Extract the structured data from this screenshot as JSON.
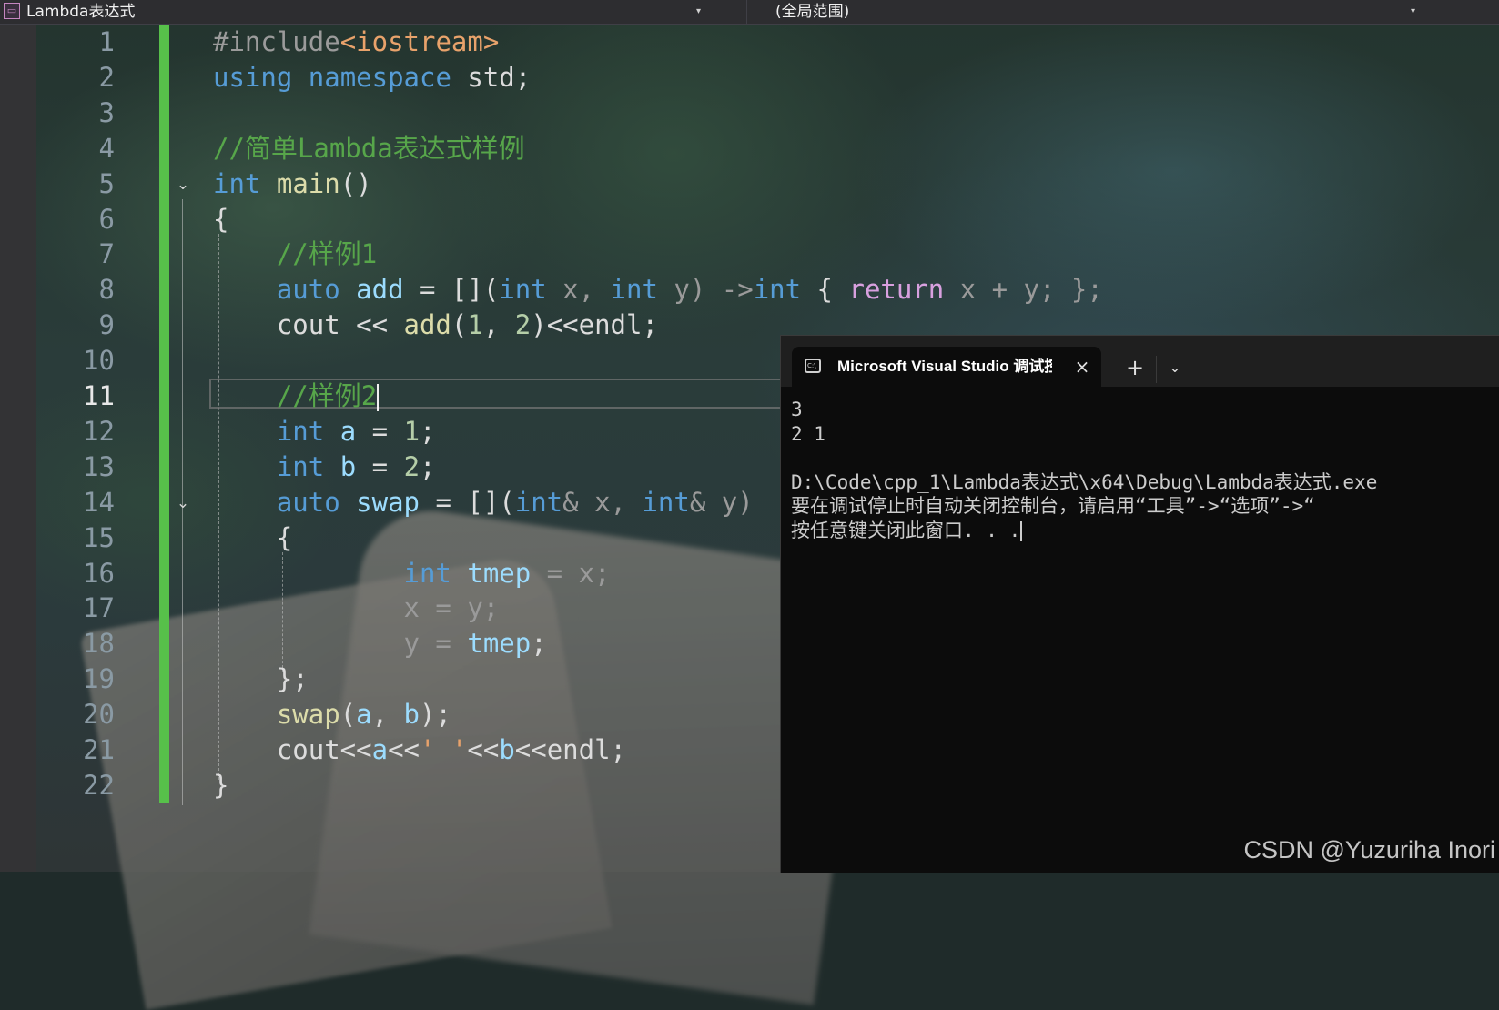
{
  "navbar": {
    "file_icon": "class-file-icon",
    "project": "Lambda表达式",
    "scope": "(全局范围)",
    "dropdown_icon": "▾"
  },
  "editor": {
    "line_numbers": [
      "1",
      "2",
      "3",
      "4",
      "5",
      "6",
      "7",
      "8",
      "9",
      "10",
      "11",
      "12",
      "13",
      "14",
      "15",
      "16",
      "17",
      "18",
      "19",
      "20",
      "21",
      "22"
    ],
    "active_line": 11,
    "fold_icon": "chevron-down-icon",
    "lines": [
      [
        {
          "t": "#include",
          "c": "pp"
        },
        {
          "t": "<iostream>",
          "c": "str"
        }
      ],
      [
        {
          "t": "using",
          "c": "kw"
        },
        {
          "t": " ",
          "c": "op"
        },
        {
          "t": "namespace",
          "c": "kw"
        },
        {
          "t": " std;",
          "c": "op"
        }
      ],
      [],
      [
        {
          "t": "//简单Lambda表达式样例",
          "c": "cm"
        }
      ],
      [
        {
          "t": "int",
          "c": "kw"
        },
        {
          "t": " ",
          "c": "op"
        },
        {
          "t": "main",
          "c": "fn"
        },
        {
          "t": "()",
          "c": "op"
        }
      ],
      [
        {
          "t": "{",
          "c": "op"
        }
      ],
      [
        {
          "t": "    ",
          "c": "op"
        },
        {
          "t": "//样例1",
          "c": "cm"
        }
      ],
      [
        {
          "t": "    ",
          "c": "op"
        },
        {
          "t": "auto",
          "c": "kw"
        },
        {
          "t": " ",
          "c": "op"
        },
        {
          "t": "add",
          "c": "id"
        },
        {
          "t": " = [](",
          "c": "op"
        },
        {
          "t": "int",
          "c": "kw"
        },
        {
          "t": " x, ",
          "c": "par-x"
        },
        {
          "t": "int",
          "c": "kw"
        },
        {
          "t": " y) ->",
          "c": "par-x"
        },
        {
          "t": "int",
          "c": "kw"
        },
        {
          "t": " { ",
          "c": "op"
        },
        {
          "t": "return",
          "c": "ret"
        },
        {
          "t": " x + y; };",
          "c": "par-x"
        }
      ],
      [
        {
          "t": "    cout << ",
          "c": "op"
        },
        {
          "t": "add",
          "c": "fn"
        },
        {
          "t": "(",
          "c": "op"
        },
        {
          "t": "1",
          "c": "num"
        },
        {
          "t": ", ",
          "c": "op"
        },
        {
          "t": "2",
          "c": "num"
        },
        {
          "t": ")<<endl;",
          "c": "op"
        }
      ],
      [],
      [
        {
          "t": "    ",
          "c": "op"
        },
        {
          "t": "//样例2",
          "c": "cm"
        }
      ],
      [
        {
          "t": "    ",
          "c": "op"
        },
        {
          "t": "int",
          "c": "kw"
        },
        {
          "t": " ",
          "c": "op"
        },
        {
          "t": "a",
          "c": "id"
        },
        {
          "t": " = ",
          "c": "op"
        },
        {
          "t": "1",
          "c": "num"
        },
        {
          "t": ";",
          "c": "op"
        }
      ],
      [
        {
          "t": "    ",
          "c": "op"
        },
        {
          "t": "int",
          "c": "kw"
        },
        {
          "t": " ",
          "c": "op"
        },
        {
          "t": "b",
          "c": "id"
        },
        {
          "t": " = ",
          "c": "op"
        },
        {
          "t": "2",
          "c": "num"
        },
        {
          "t": ";",
          "c": "op"
        }
      ],
      [
        {
          "t": "    ",
          "c": "op"
        },
        {
          "t": "auto",
          "c": "kw"
        },
        {
          "t": " ",
          "c": "op"
        },
        {
          "t": "swap",
          "c": "id"
        },
        {
          "t": " = [](",
          "c": "op"
        },
        {
          "t": "int",
          "c": "kw"
        },
        {
          "t": "& x, ",
          "c": "par-x"
        },
        {
          "t": "int",
          "c": "kw"
        },
        {
          "t": "& y)",
          "c": "par-x"
        }
      ],
      [
        {
          "t": "    {",
          "c": "op"
        }
      ],
      [
        {
          "t": "            ",
          "c": "op"
        },
        {
          "t": "int",
          "c": "kw"
        },
        {
          "t": " ",
          "c": "op"
        },
        {
          "t": "tmep",
          "c": "id"
        },
        {
          "t": " = x;",
          "c": "par-x"
        }
      ],
      [
        {
          "t": "            x = y;",
          "c": "par-x"
        }
      ],
      [
        {
          "t": "            y = ",
          "c": "par-x"
        },
        {
          "t": "tmep",
          "c": "id"
        },
        {
          "t": ";",
          "c": "op"
        }
      ],
      [
        {
          "t": "    };",
          "c": "op"
        }
      ],
      [
        {
          "t": "    ",
          "c": "op"
        },
        {
          "t": "swap",
          "c": "fn"
        },
        {
          "t": "(",
          "c": "op"
        },
        {
          "t": "a",
          "c": "id"
        },
        {
          "t": ", ",
          "c": "op"
        },
        {
          "t": "b",
          "c": "id"
        },
        {
          "t": ");",
          "c": "op"
        }
      ],
      [
        {
          "t": "    cout<<",
          "c": "op"
        },
        {
          "t": "a",
          "c": "id"
        },
        {
          "t": "<<",
          "c": "op"
        },
        {
          "t": "' '",
          "c": "str"
        },
        {
          "t": "<<",
          "c": "op"
        },
        {
          "t": "b",
          "c": "id"
        },
        {
          "t": "<<endl;",
          "c": "op"
        }
      ],
      [
        {
          "t": "}",
          "c": "op"
        }
      ]
    ]
  },
  "console": {
    "tab_icon": "terminal-icon",
    "tab_title": "Microsoft Visual Studio 调试控制台",
    "close_icon": "×",
    "new_tab_icon": "+",
    "dropdown_icon": "⌄",
    "output": [
      "3",
      "2 1",
      "",
      "D:\\Code\\cpp_1\\Lambda表达式\\x64\\Debug\\Lambda表达式.exe",
      "要在调试停止时自动关闭控制台，请启用“工具”->“选项”->“",
      "按任意键关闭此窗口. . ."
    ]
  },
  "watermark": "CSDN @Yuzuriha  Inori"
}
